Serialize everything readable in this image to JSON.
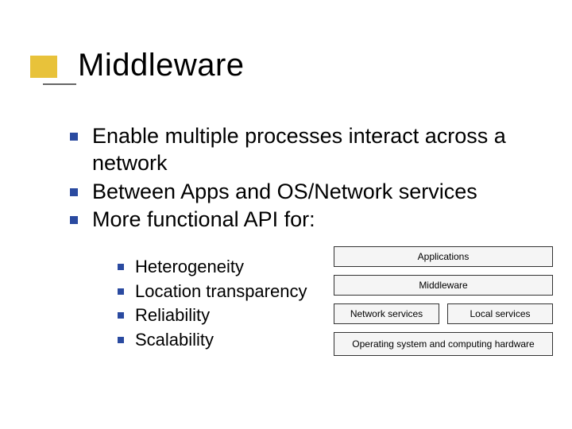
{
  "title": "Middleware",
  "bullets_level1": [
    "Enable multiple processes interact across a network",
    "Between Apps and OS/Network services",
    "More functional API for:"
  ],
  "bullets_level2": [
    "Heterogeneity",
    "Location transparency",
    "Reliability",
    "Scalability"
  ],
  "diagram": {
    "row1": "Applications",
    "row2": "Middleware",
    "row3_left": "Network services",
    "row3_right": "Local services",
    "row4": "Operating system and computing hardware"
  }
}
